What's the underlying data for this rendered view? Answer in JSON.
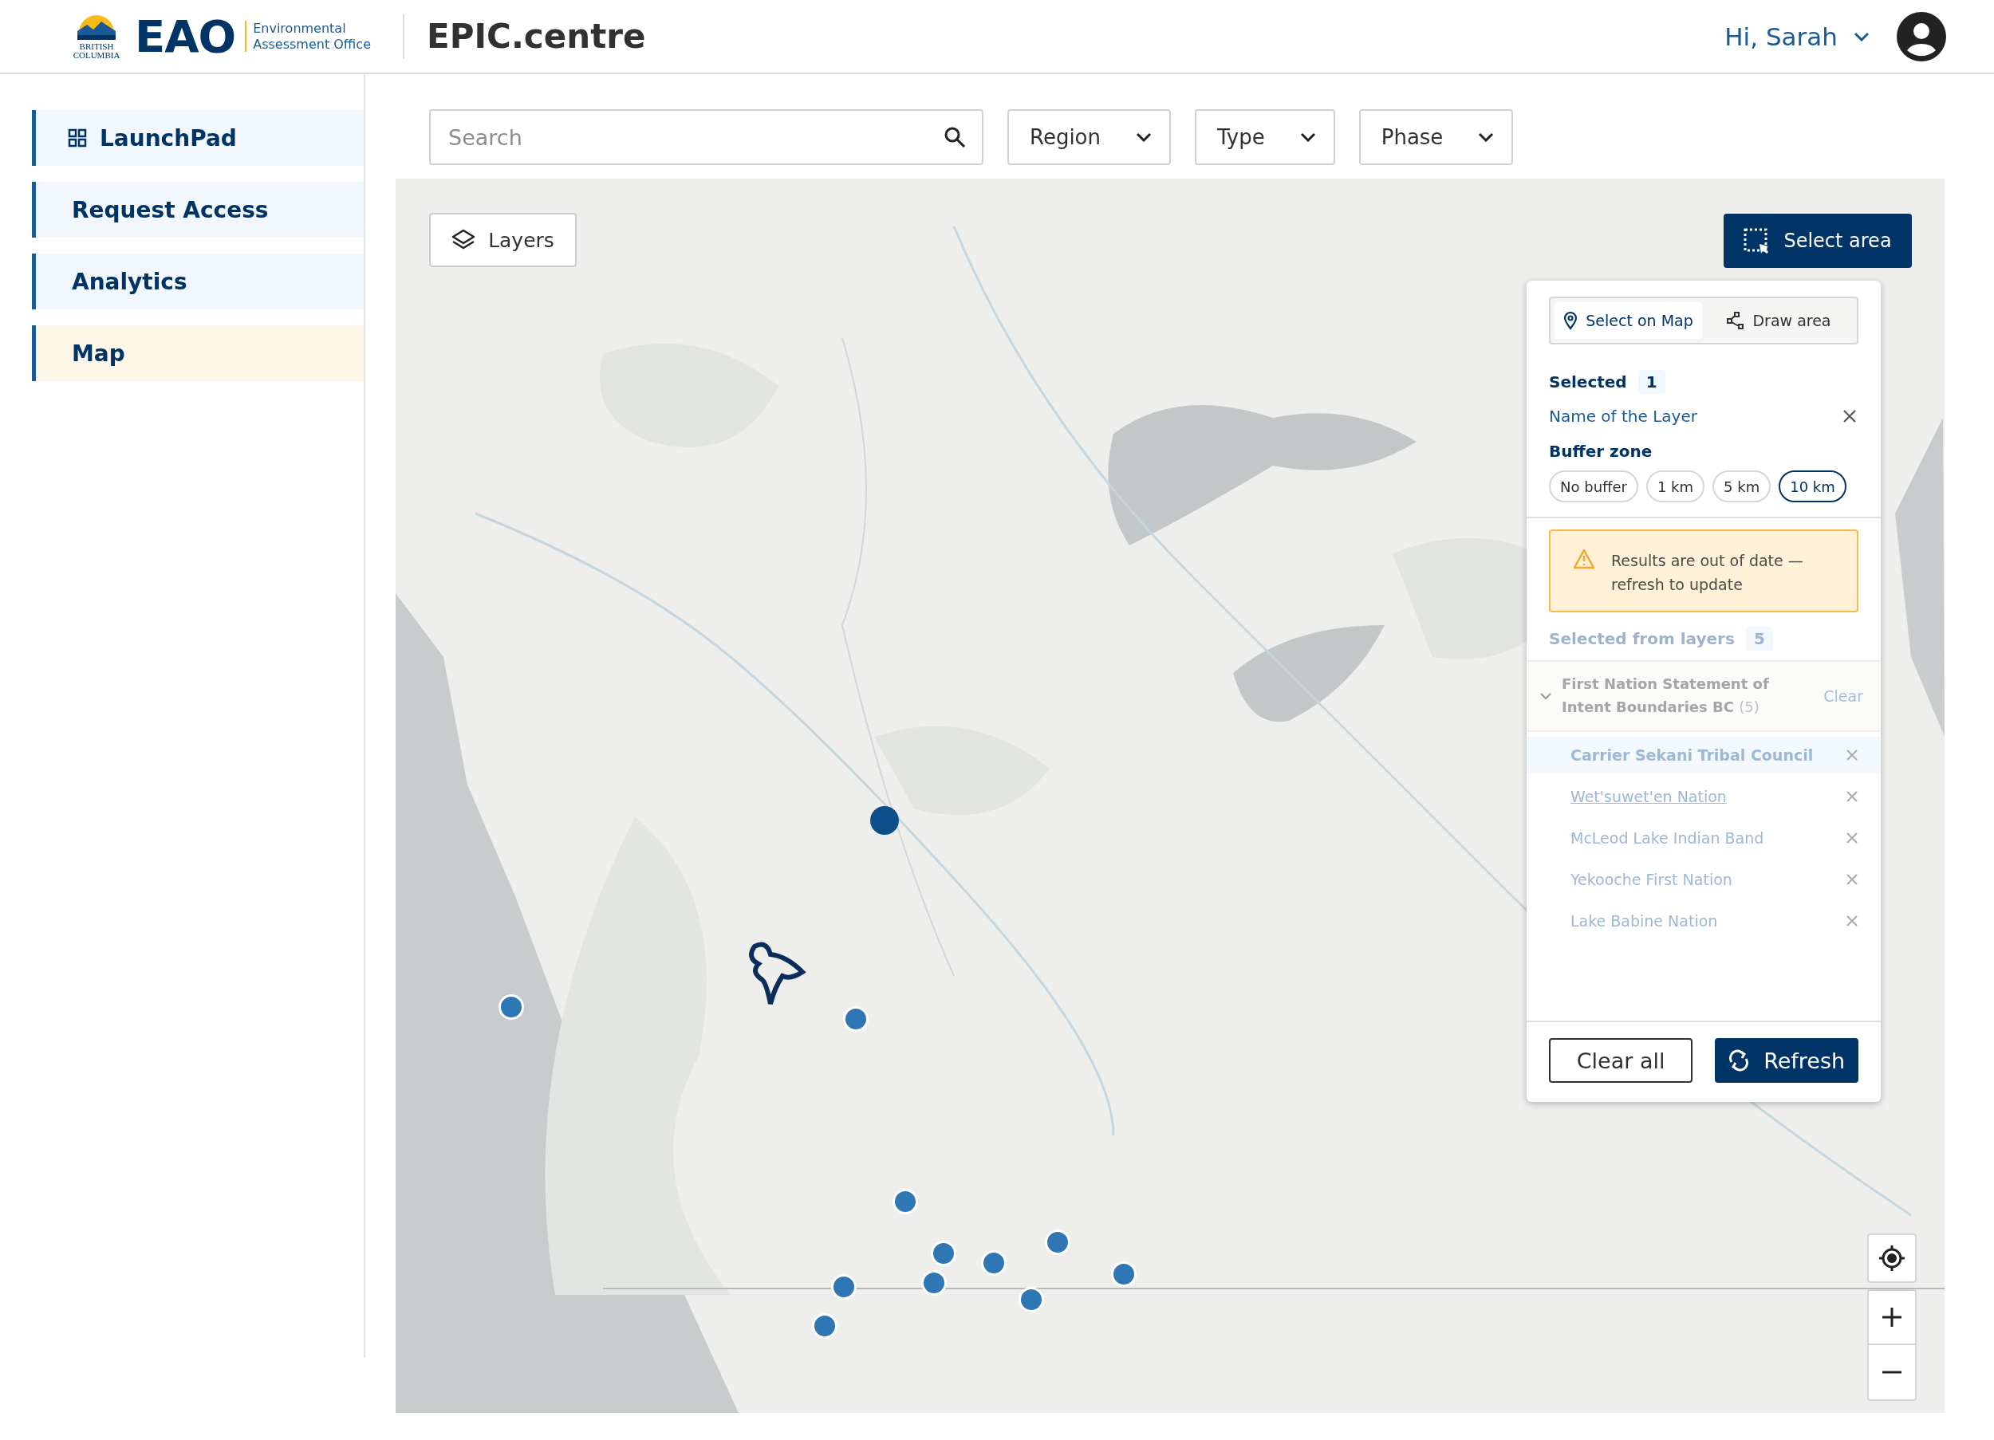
{
  "header": {
    "logo": {
      "crest_text": "BRITISH COLUMBIA",
      "wordmark": "EAO",
      "subtitle_lines": [
        "Environmental",
        "Assessment Office"
      ]
    },
    "app_title": "EPIC.centre",
    "user": {
      "greeting": "Hi, Sarah"
    }
  },
  "sidebar": {
    "items": [
      {
        "label": "LaunchPad",
        "has_icon": true,
        "selected": false
      },
      {
        "label": "Request Access",
        "has_icon": false,
        "selected": false
      },
      {
        "label": "Analytics",
        "has_icon": false,
        "selected": false
      },
      {
        "label": "Map",
        "has_icon": false,
        "selected": true
      }
    ]
  },
  "filters": {
    "search": {
      "placeholder": "Search"
    },
    "dropdowns": [
      "Region",
      "Type",
      "Phase"
    ]
  },
  "map": {
    "layers_button": "Layers",
    "select_area_button": "Select area",
    "panel": {
      "modes": [
        {
          "label": "Select on Map",
          "kind": "pin",
          "selected": true
        },
        {
          "label": "Draw area",
          "kind": "draw",
          "selected": false
        }
      ],
      "selected_label": "Selected",
      "selected_count": "1",
      "layer_name": "Name of the Layer",
      "buffer_title": "Buffer zone",
      "buffers": [
        {
          "label": "No buffer",
          "selected": false
        },
        {
          "label": "1 km",
          "selected": false
        },
        {
          "label": "5 km",
          "selected": false
        },
        {
          "label": "10 km",
          "selected": true
        }
      ],
      "warning": "Results are out of date — refresh to update",
      "from_layers_label": "Selected from layers",
      "from_layers_count": "5",
      "group": {
        "title": "First Nation Statement of Intent Boundaries BC",
        "count": "(5)",
        "expanded": true,
        "clear": "Clear",
        "items": [
          {
            "label": "Carrier Sekani Tribal Council",
            "selected": true,
            "hovered": false
          },
          {
            "label": "Wet'suwet'en Nation",
            "selected": false,
            "hovered": true
          },
          {
            "label": "McLeod Lake Indian Band",
            "selected": false,
            "hovered": false
          },
          {
            "label": "Yekooche First Nation",
            "selected": false,
            "hovered": false
          },
          {
            "label": "Lake Babine Nation",
            "selected": false,
            "hovered": false
          }
        ]
      },
      "clear_all": "Clear all",
      "refresh": "Refresh"
    }
  }
}
